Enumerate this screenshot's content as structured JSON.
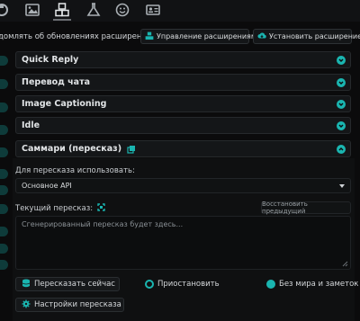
{
  "top_tabs": [
    {
      "icon": "plug-icon"
    },
    {
      "icon": "image-icon"
    },
    {
      "icon": "cubes-icon"
    },
    {
      "icon": "flask-icon"
    },
    {
      "icon": "smile-icon"
    },
    {
      "icon": "id-card-icon"
    }
  ],
  "toolbar": {
    "notify_label": "домлять об обновлениях расширений",
    "manage_label": "Управление расширениями",
    "install_label": "Установить расширение"
  },
  "drawers": [
    {
      "label": "Quick Reply"
    },
    {
      "label": "Перевод чата"
    },
    {
      "label": "Image Captioning"
    },
    {
      "label": "Idle"
    },
    {
      "label": "Саммари (пересказ)"
    }
  ],
  "summary": {
    "source_label": "Для пересказа использовать:",
    "source_value": "Основное API",
    "current_label": "Текущий пересказ:",
    "restore_label": "Восстановить предыдущий",
    "placeholder": "Сгенерированный пересказ будет здесь...",
    "summarize_now": "Пересказать сейчас",
    "pause": "Приостановить",
    "no_wi": "Без мира и заметок",
    "settings": "Настройки пересказа"
  },
  "colors": {
    "accent": "#1ab5b0",
    "background": "#0b0b0c",
    "drawer": "#141618"
  }
}
